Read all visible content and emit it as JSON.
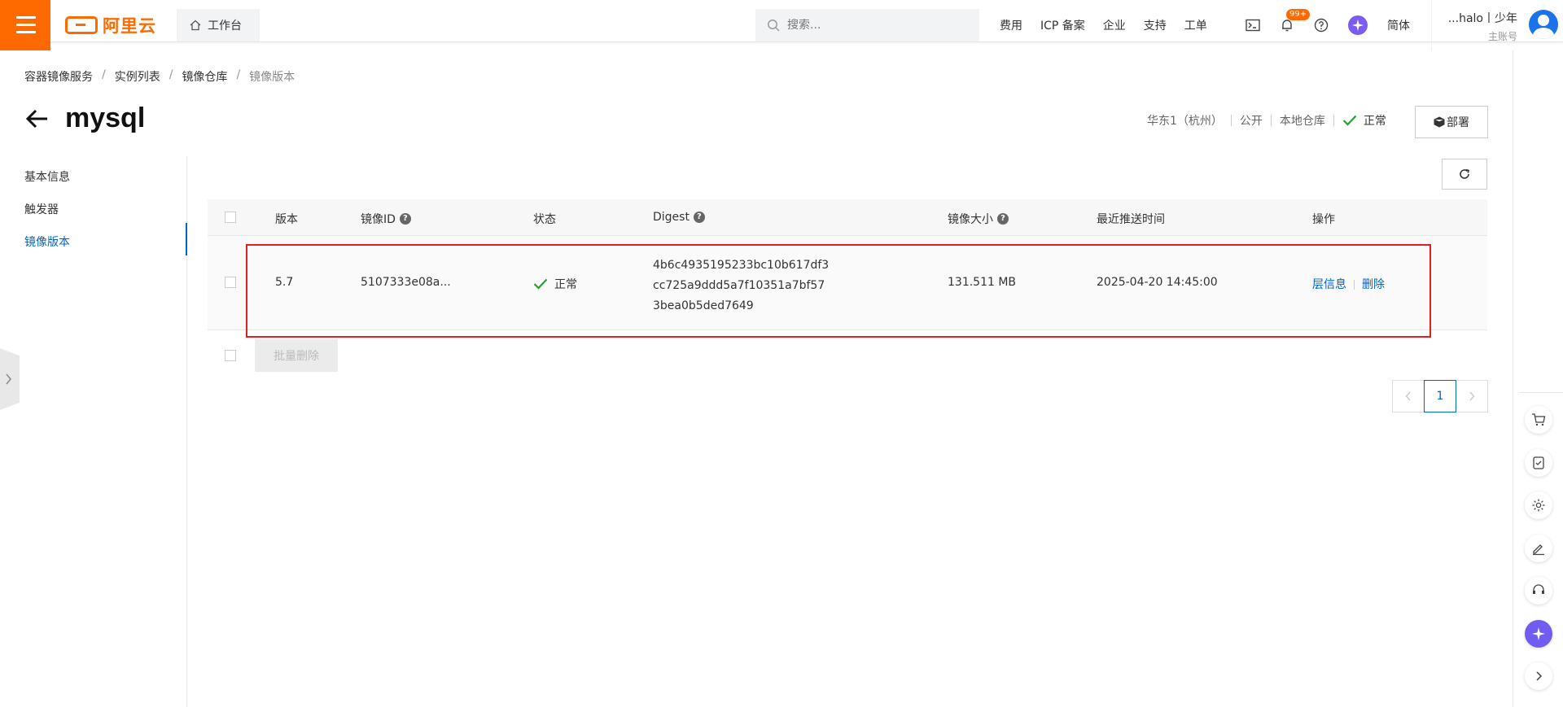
{
  "topbar": {
    "logo_text": "阿里云",
    "workbench_label": "工作台",
    "search_placeholder": "搜索...",
    "links": [
      "费用",
      "ICP 备案",
      "企业",
      "支持",
      "工单"
    ],
    "notification_badge": "99+",
    "language": "简体",
    "user_name": "...halo丨少年",
    "user_role": "主账号"
  },
  "breadcrumb": [
    "容器镜像服务",
    "实例列表",
    "镜像仓库",
    "镜像版本"
  ],
  "page": {
    "title": "mysql",
    "region": "华东1（杭州）",
    "visibility": "公开",
    "repo_type": "本地仓库",
    "status": "正常",
    "deploy_label": "部署"
  },
  "sidenav": {
    "items": [
      "基本信息",
      "触发器",
      "镜像版本"
    ],
    "active_index": 2
  },
  "table": {
    "columns": [
      "版本",
      "镜像ID",
      "状态",
      "Digest",
      "镜像大小",
      "最近推送时间",
      "操作"
    ],
    "rows": [
      {
        "version": "5.7",
        "image_id": "5107333e08a...",
        "status": "正常",
        "digest_lines": [
          "4b6c4935195233bc10b617df3",
          "cc725a9ddd5a7f10351a7bf57",
          "3bea0b5ded7649"
        ],
        "size": "131.511 MB",
        "pushed_at": "2025-04-20 14:45:00",
        "action_layers": "层信息",
        "action_delete": "删除"
      }
    ],
    "batch_delete_label": "批量删除"
  },
  "pagination": {
    "current_page": "1"
  },
  "colors": {
    "brand": "#ff6a00",
    "link": "#0064c8",
    "success": "#23a333",
    "highlight": "#e02020"
  }
}
